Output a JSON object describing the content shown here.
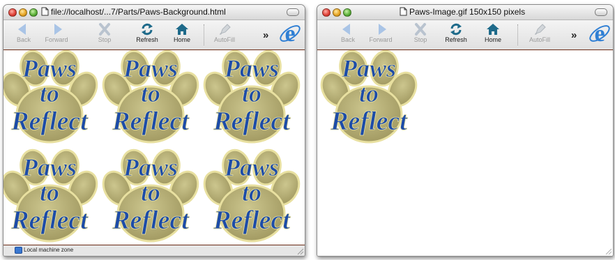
{
  "windows": {
    "left": {
      "title": "file://localhost/...7/Parts/Paws-Background.html",
      "status": "Local machine zone"
    },
    "right": {
      "title": "Paws-Image.gif 150x150 pixels"
    }
  },
  "toolbar": {
    "back": "Back",
    "forward": "Forward",
    "stop": "Stop",
    "refresh": "Refresh",
    "home": "Home",
    "autofill": "AutoFill",
    "more": "»"
  },
  "paw_image": {
    "line1": "Paws",
    "line2": "to",
    "line3": "Reflect"
  },
  "colors": {
    "paw_fill": "#b4ad7a",
    "paw_outline": "#e8e0a0",
    "text_blue": "#1d4ca8",
    "toolbar_rule": "#6b2b16",
    "accent_blue": "#2f7fd4"
  },
  "icons": {
    "back": "arrow-left-icon",
    "forward": "arrow-right-icon",
    "stop": "x-icon",
    "refresh": "circular-arrows-icon",
    "home": "house-icon",
    "autofill": "pencil-icon",
    "browser": "internet-explorer-logo"
  }
}
